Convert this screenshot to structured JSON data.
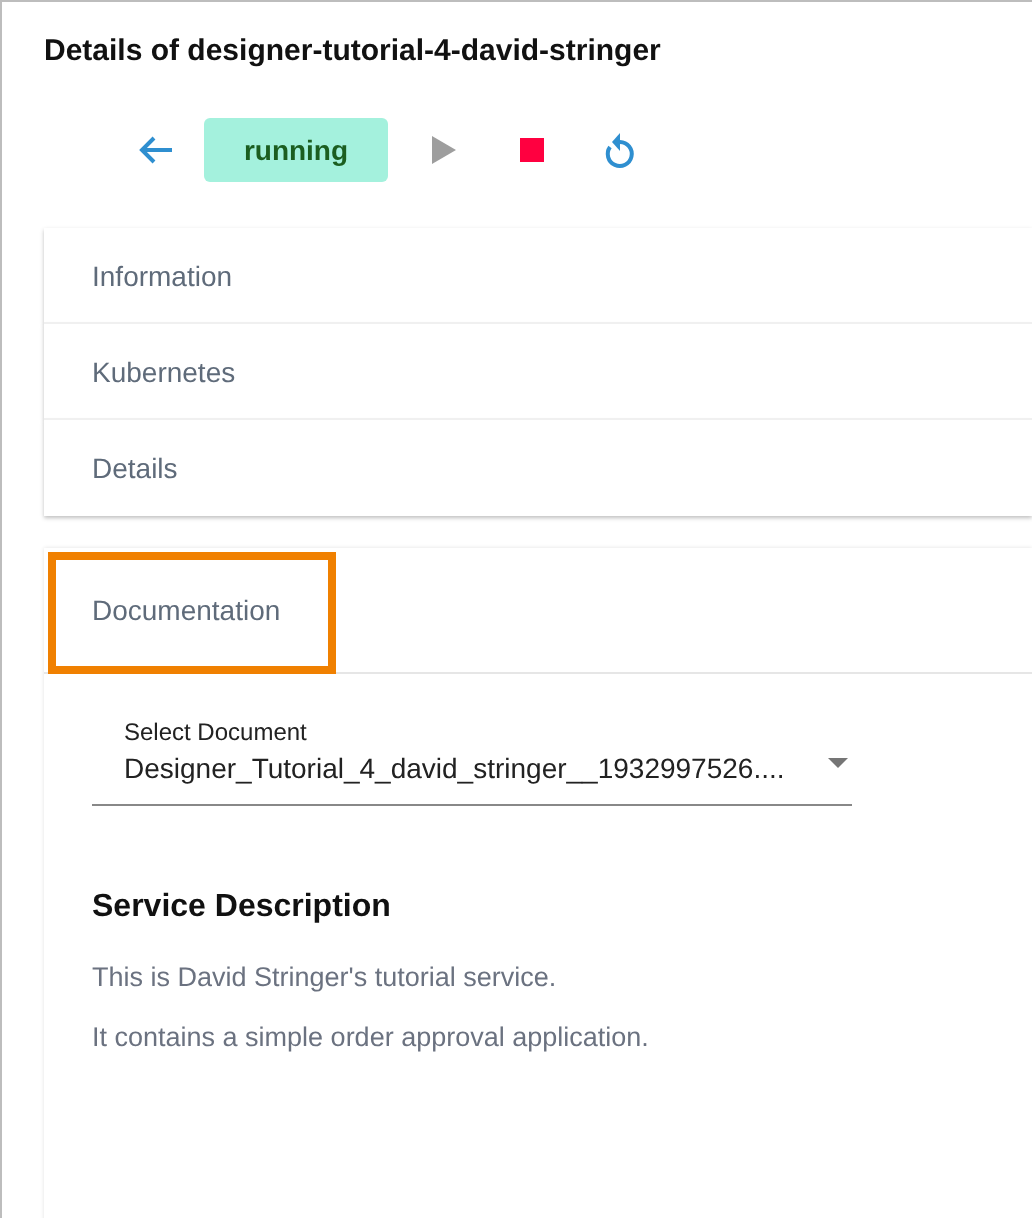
{
  "title": "Details of designer-tutorial-4-david-stringer",
  "toolbar": {
    "status": "running",
    "actions": [
      {
        "kind": "back",
        "disabled": false
      },
      {
        "kind": "start",
        "disabled": true
      },
      {
        "kind": "stop",
        "disabled": false
      },
      {
        "kind": "restart",
        "disabled": false
      }
    ]
  },
  "panels": [
    {
      "label": "Information",
      "expanded": false,
      "highlighted": false
    },
    {
      "label": "Kubernetes",
      "expanded": false,
      "highlighted": false
    },
    {
      "label": "Details",
      "expanded": false,
      "highlighted": false
    },
    {
      "label": "Documentation",
      "expanded": true,
      "highlighted": true
    }
  ],
  "documentation": {
    "select": {
      "label": "Select Document",
      "value": "Designer_Tutorial_4_david_stringer__1932997526...."
    },
    "heading": "Service Description",
    "paragraphs": [
      "This is David Stringer's tutorial service.",
      "It contains a simple order approval application."
    ]
  }
}
